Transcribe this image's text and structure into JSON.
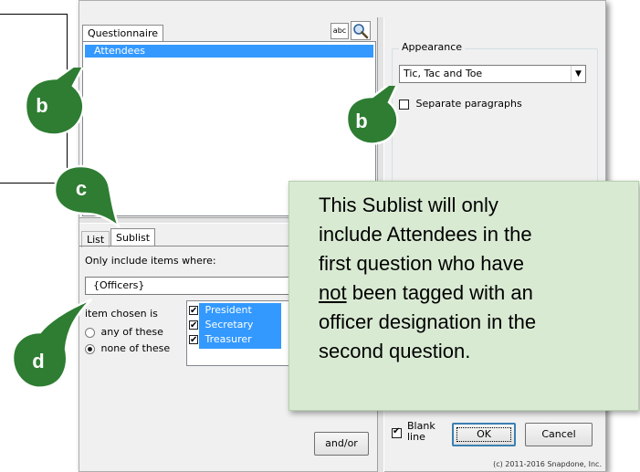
{
  "questionnaire_tab": "Questionnaire",
  "search_icon_text": "abc",
  "attendees_list": [
    "Attendees"
  ],
  "appearance": {
    "legend": "Appearance",
    "style_value": "Tic, Tac and Toe",
    "separate_paragraphs": "Separate paragraphs"
  },
  "lower_tabs": {
    "list": "List",
    "sublist": "Sublist"
  },
  "sublist": {
    "only_include_label": "Only include items where:",
    "field_value": "{Officers}",
    "item_chosen_label": "item chosen is",
    "radio_any": "any of these",
    "radio_none": "none of these",
    "options": [
      "President",
      "Secretary",
      "Treasurer"
    ]
  },
  "buttons": {
    "and_or": "and/or",
    "ok": "OK",
    "cancel": "Cancel"
  },
  "blank_line": {
    "line1": "Blank",
    "line2": "line"
  },
  "copyright": "(c) 2011-2016 Snapdone, Inc.",
  "callouts": {
    "b1": "b",
    "b2": "b",
    "c": "c",
    "d": "d"
  },
  "note": {
    "line1": "This Sublist will only",
    "line2": "include Attendees in the",
    "line3": "first question who have",
    "underlined_word": "not",
    "line4_rest": " been tagged with an",
    "line5": "officer designation in the",
    "line6": "second question."
  },
  "colors": {
    "callout_green": "#2e7d32",
    "selection_blue": "#3399ff",
    "note_bg": "#d9ead3"
  }
}
